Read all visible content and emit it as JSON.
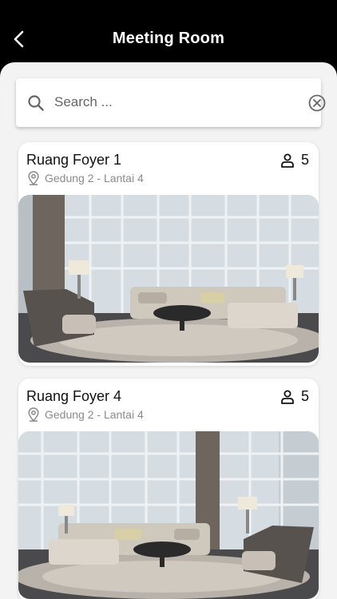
{
  "header": {
    "title": "Meeting Room",
    "back_icon": "chevron-left-icon"
  },
  "search": {
    "placeholder": "Search ...",
    "value": "",
    "icons": [
      "search-icon",
      "clear-circle-icon"
    ]
  },
  "rooms": [
    {
      "name": "Ruang Foyer 1",
      "capacity": "5",
      "location": "Gedung 2 - Lantai 4"
    },
    {
      "name": "Ruang Foyer 4",
      "capacity": "5",
      "location": "Gedung 2 - Lantai 4"
    }
  ],
  "colors": {
    "header_bg": "#000000",
    "sheet_bg": "#f3f3f3",
    "card_bg": "#ffffff",
    "muted_text": "#8a8a8a"
  }
}
